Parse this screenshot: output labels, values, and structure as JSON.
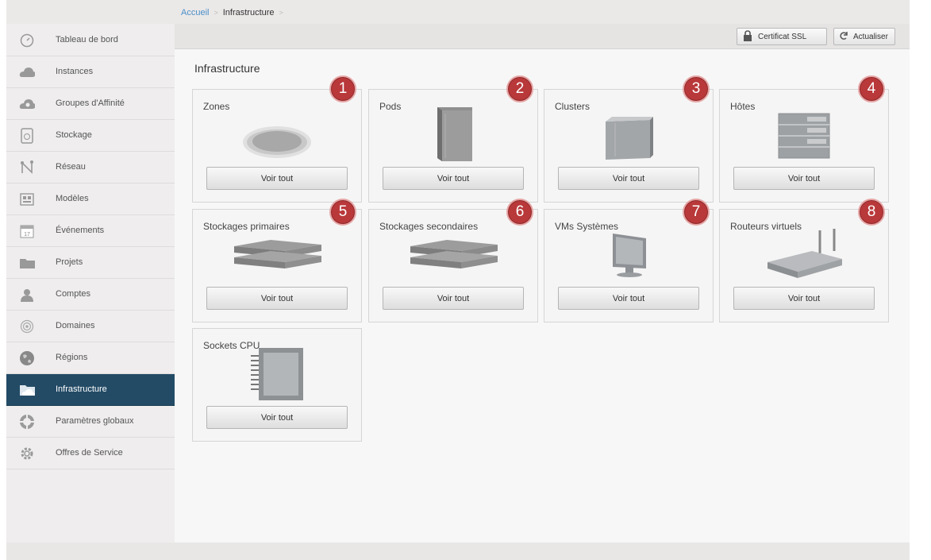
{
  "breadcrumb": {
    "home": "Accueil",
    "current": "Infrastructure",
    "sep": ">"
  },
  "toolbar": {
    "ssl_label": "Certificat SSL",
    "refresh_label": "Actualiser"
  },
  "page": {
    "title": "Infrastructure"
  },
  "sidebar": {
    "items": [
      {
        "label": "Tableau de bord",
        "icon": "dashboard-icon"
      },
      {
        "label": "Instances",
        "icon": "cloud-icon"
      },
      {
        "label": "Groupes d'Affinité",
        "icon": "affinity-group-icon"
      },
      {
        "label": "Stockage",
        "icon": "storage-icon"
      },
      {
        "label": "Réseau",
        "icon": "network-icon"
      },
      {
        "label": "Modèles",
        "icon": "templates-icon"
      },
      {
        "label": "Événements",
        "icon": "calendar-icon"
      },
      {
        "label": "Projets",
        "icon": "folder-icon"
      },
      {
        "label": "Comptes",
        "icon": "user-icon"
      },
      {
        "label": "Domaines",
        "icon": "domain-icon"
      },
      {
        "label": "Régions",
        "icon": "globe-icon"
      },
      {
        "label": "Infrastructure",
        "icon": "infrastructure-icon",
        "active": true
      },
      {
        "label": "Paramètres globaux",
        "icon": "global-settings-icon"
      },
      {
        "label": "Offres de Service",
        "icon": "gear-icon"
      }
    ]
  },
  "cards": [
    {
      "title": "Zones",
      "button": "Voir tout",
      "badge": "1",
      "icon": "zone-icon"
    },
    {
      "title": "Pods",
      "button": "Voir tout",
      "badge": "2",
      "icon": "pod-icon"
    },
    {
      "title": "Clusters",
      "button": "Voir tout",
      "badge": "3",
      "icon": "cluster-icon"
    },
    {
      "title": "Hôtes",
      "button": "Voir tout",
      "badge": "4",
      "icon": "host-icon"
    },
    {
      "title": "Stockages primaires",
      "button": "Voir tout",
      "badge": "5",
      "icon": "primary-storage-icon"
    },
    {
      "title": "Stockages secondaires",
      "button": "Voir tout",
      "badge": "6",
      "icon": "secondary-storage-icon"
    },
    {
      "title": "VMs Systèmes",
      "button": "Voir tout",
      "badge": "7",
      "icon": "monitor-icon"
    },
    {
      "title": "Routeurs virtuels",
      "button": "Voir tout",
      "badge": "8",
      "icon": "router-icon"
    },
    {
      "title": "Sockets CPU",
      "button": "Voir tout",
      "icon": "cpu-icon"
    }
  ],
  "colors": {
    "active_sidebar": "#234b66",
    "badge": "#b9383a",
    "link": "#4a90c8"
  }
}
